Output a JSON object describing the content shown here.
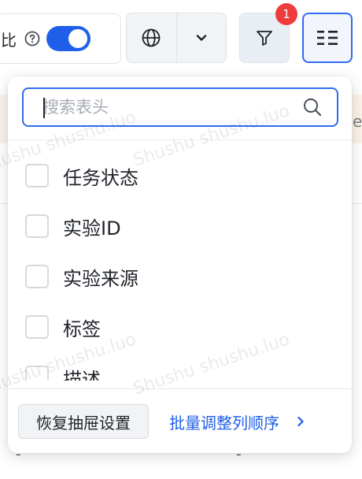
{
  "toolbar": {
    "compare_label": "比",
    "help_icon": "question-circle-icon",
    "toggle_on": true,
    "language_icon": "globe-icon",
    "dropdown_icon": "chevron-down-icon",
    "filter_icon": "filter-funnel-icon",
    "filter_badge": "1",
    "columns_icon": "column-list-icon"
  },
  "column_panel": {
    "search": {
      "placeholder": "搜索表头",
      "value": ""
    },
    "items": [
      {
        "label": "任务状态",
        "checked": false
      },
      {
        "label": "实验ID",
        "checked": false
      },
      {
        "label": "实验来源",
        "checked": false
      },
      {
        "label": "标签",
        "checked": false
      },
      {
        "label": "描述",
        "checked": false
      }
    ],
    "reset_label": "恢复抽屉设置",
    "batch_label": "批量调整列顺序"
  },
  "background": {
    "cell_fragment": "e",
    "empty_cells": [
      "-",
      "-"
    ]
  },
  "watermark": "Shushu shushu.luo",
  "colors": {
    "accent": "#1f5ee8",
    "badge": "#ee3c3c"
  }
}
